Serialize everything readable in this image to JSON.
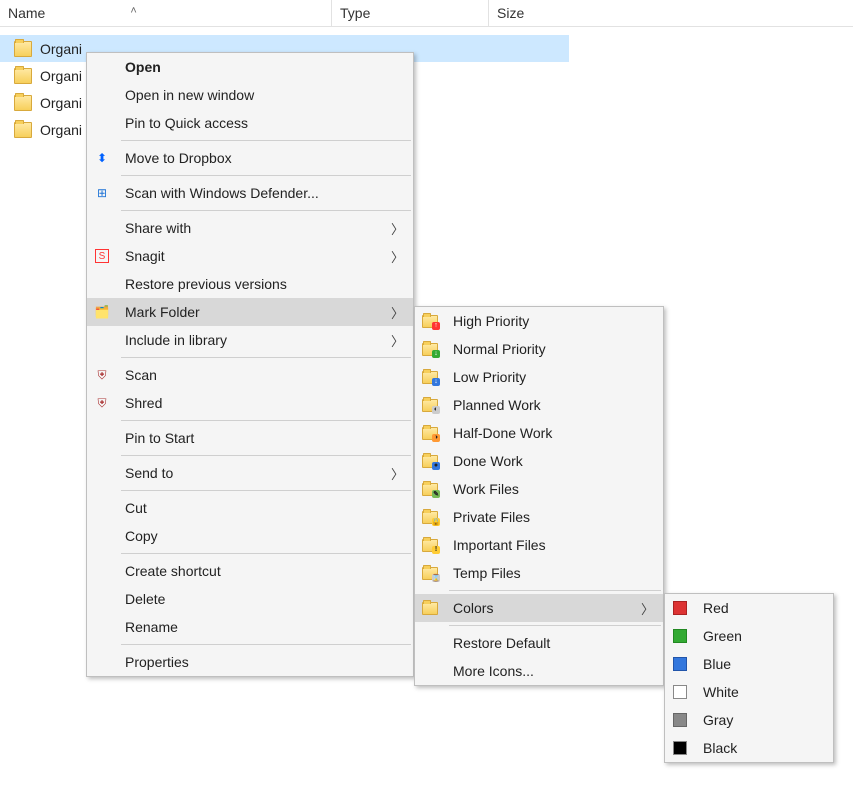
{
  "columns": {
    "name": "Name",
    "type": "Type",
    "size": "Size"
  },
  "rows": [
    {
      "label": "Organi",
      "selected": true
    },
    {
      "label": "Organi",
      "selected": false
    },
    {
      "label": "Organi",
      "selected": false
    },
    {
      "label": "Organi",
      "selected": false
    }
  ],
  "menu1": {
    "open": "Open",
    "open_new": "Open in new window",
    "pin_quick": "Pin to Quick access",
    "move_dropbox": "Move to Dropbox",
    "defender": "Scan with Windows Defender...",
    "share_with": "Share with",
    "snagit": "Snagit",
    "restore_prev": "Restore previous versions",
    "mark_folder": "Mark Folder",
    "include_library": "Include in library",
    "scan": "Scan",
    "shred": "Shred",
    "pin_start": "Pin to Start",
    "send_to": "Send to",
    "cut": "Cut",
    "copy": "Copy",
    "create_shortcut": "Create shortcut",
    "delete": "Delete",
    "rename": "Rename",
    "properties": "Properties"
  },
  "menu2": {
    "high_priority": "High Priority",
    "normal_priority": "Normal Priority",
    "low_priority": "Low Priority",
    "planned": "Planned Work",
    "halfdone": "Half-Done Work",
    "done": "Done Work",
    "work_files": "Work Files",
    "private_files": "Private Files",
    "important_files": "Important Files",
    "temp_files": "Temp Files",
    "colors": "Colors",
    "restore_default": "Restore Default",
    "more_icons": "More Icons..."
  },
  "menu3": {
    "red": "Red",
    "green": "Green",
    "blue": "Blue",
    "white": "White",
    "gray": "Gray",
    "black": "Black"
  }
}
